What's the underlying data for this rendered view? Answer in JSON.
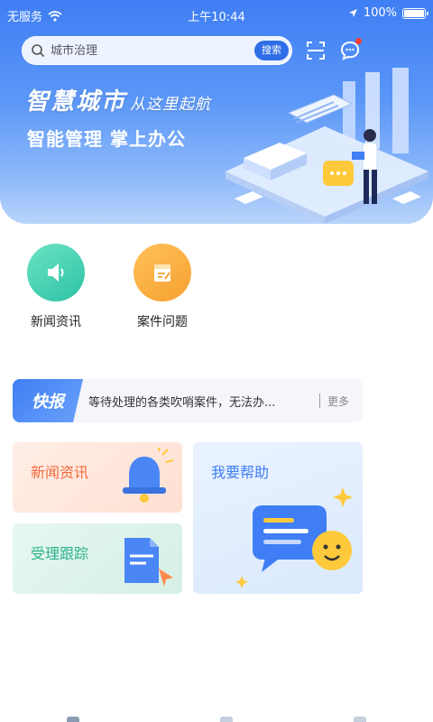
{
  "status_bar": {
    "carrier": "无服务",
    "time": "上午10:44",
    "battery": "100%"
  },
  "search": {
    "placeholder": "城市治理",
    "button_label": "搜索"
  },
  "hero": {
    "title": "智慧城市",
    "title_tail": "从这里起航",
    "subtitle": "智能管理 掌上办公"
  },
  "quick_entries": [
    {
      "label": "新闻资讯",
      "icon": "speaker-icon",
      "color": "#2dc2a6"
    },
    {
      "label": "案件问题",
      "icon": "notepad-icon",
      "color": "#f6a12f"
    }
  ],
  "flash_news": {
    "tag": "快报",
    "text": "等待处理的各类吹哨案件，无法办...",
    "more": "更多"
  },
  "cards": {
    "news": {
      "title": "新闻资讯",
      "icon": "bell-icon"
    },
    "tracking": {
      "title": "受理跟踪",
      "icon": "document-pointer-icon"
    },
    "help": {
      "title": "我要帮助",
      "icon": "chat-smile-icon"
    }
  },
  "colors": {
    "primary": "#3f7ef4",
    "news_card_text": "#f46a3e",
    "tracking_card_text": "#2ab08a"
  }
}
